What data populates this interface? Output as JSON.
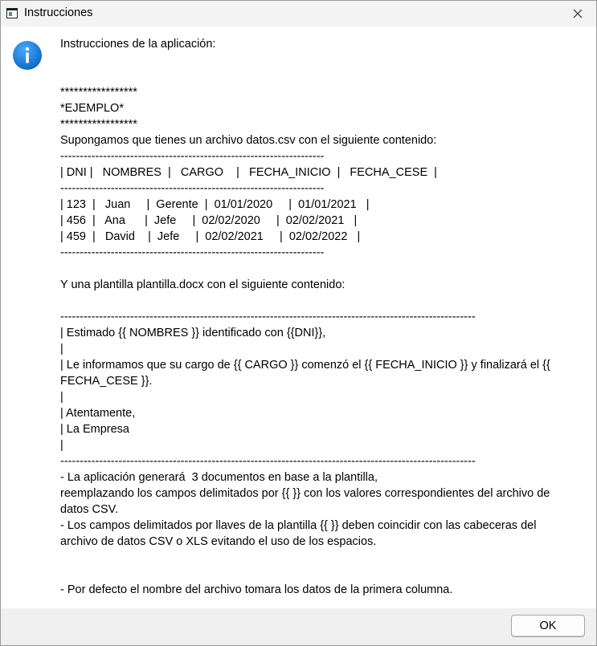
{
  "window": {
    "title": "Instrucciones"
  },
  "icons": {
    "info": "info-icon",
    "close": "close-icon",
    "app": "app-window-icon"
  },
  "colors": {
    "info_blue": "#1a7fd4"
  },
  "message": {
    "lines": [
      "Instrucciones de la aplicación:",
      "",
      "",
      "*****************",
      "*EJEMPLO*",
      "*****************",
      "Supongamos que tienes un archivo datos.csv con el siguiente contenido:",
      "--------------------------------------------------------------------",
      "| DNI |   NOMBRES  |   CARGO    |   FECHA_INICIO  |   FECHA_CESE  |",
      "--------------------------------------------------------------------",
      "| 123  |   Juan     |  Gerente  |  01/01/2020     |  01/01/2021   |",
      "| 456  |   Ana      |  Jefe     |  02/02/2020     |  02/02/2021   |",
      "| 459  |   David    |  Jefe     |  02/02/2021     |  02/02/2022   |",
      "--------------------------------------------------------------------",
      "",
      "Y una plantilla plantilla.docx con el siguiente contenido:",
      "",
      "-----------------------------------------------------------------------------------------------------------",
      "| Estimado {{ NOMBRES }} identificado con {{DNI}},",
      "|",
      "| Le informamos que su cargo de {{ CARGO }} comenzó el {{ FECHA_INICIO }} y finalizará el {{",
      "FECHA_CESE }}.",
      "|",
      "| Atentamente,",
      "| La Empresa",
      "|",
      "-----------------------------------------------------------------------------------------------------------",
      "- La aplicación generará  3 documentos en base a la plantilla,",
      "reemplazando los campos delimitados por {{ }} con los valores correspondientes del archivo de",
      "datos CSV.",
      "- Los campos delimitados por llaves de la plantilla {{ }} deben coincidir con las cabeceras del",
      "archivo de datos CSV o XLS evitando el uso de los espacios.",
      "",
      "",
      "- Por defecto el nombre del archivo tomara los datos de la primera columna."
    ]
  },
  "buttons": {
    "ok_label": "OK"
  }
}
